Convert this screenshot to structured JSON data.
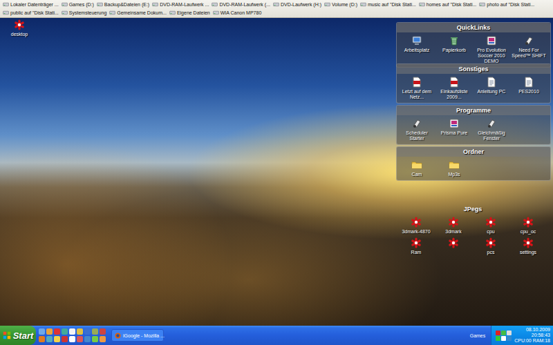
{
  "toolbar": {
    "rows": [
      [
        {
          "label": "Lokaler Datenträger ..."
        },
        {
          "label": "Games (D:)"
        },
        {
          "label": "Backup&Dateien (E:)"
        },
        {
          "label": "DVD-RAM-Laufwerk ..."
        },
        {
          "label": "DVD-RAM-Laufwerk (..."
        },
        {
          "label": "DVD-Laufwerk (H:)"
        },
        {
          "label": "Volume (D:)"
        },
        {
          "label": "music auf \"Disk Stati..."
        },
        {
          "label": "homes auf \"Disk Stati..."
        },
        {
          "label": "photo auf \"Disk Stati..."
        }
      ],
      [
        {
          "label": "public auf \"Disk Stati..."
        },
        {
          "label": "Systemsteuerung"
        },
        {
          "label": "Gemeinsame Dokum..."
        },
        {
          "label": "Eigene Dateien"
        },
        {
          "label": "WIA Canon MP780"
        }
      ]
    ]
  },
  "desktop_icons": [
    {
      "label": "desktop"
    }
  ],
  "fences": [
    {
      "title": "QuickLinks",
      "framed": true,
      "items": [
        {
          "label": "Arbeitsplatz",
          "kind": "computer"
        },
        {
          "label": "Papierkorb",
          "kind": "trash"
        },
        {
          "label": "Pro Evolution Soccer 2010 DEMO",
          "kind": "game"
        },
        {
          "label": "Need For Speed™ SHIFT",
          "kind": "app"
        }
      ]
    },
    {
      "title": "Sonstiges",
      "framed": true,
      "items": [
        {
          "label": "Letzt auf dem Netz...",
          "kind": "pdf"
        },
        {
          "label": "Einkaufsliste 2009...",
          "kind": "pdf"
        },
        {
          "label": "Anleitung PC",
          "kind": "doc"
        },
        {
          "label": "PES2010",
          "kind": "doc"
        }
      ]
    },
    {
      "title": "Programme",
      "framed": true,
      "items": [
        {
          "label": "Scheduler Starter",
          "kind": "app"
        },
        {
          "label": "Prisma Pure",
          "kind": "game"
        },
        {
          "label": "Gleichmäßig Fenster",
          "kind": "app"
        }
      ]
    },
    {
      "title": "Ordner",
      "framed": true,
      "items": [
        {
          "label": "Cam",
          "kind": "folder"
        },
        {
          "label": "Mp3s",
          "kind": "folder"
        }
      ]
    },
    {
      "title": "JPegs",
      "framed": false,
      "items": [
        {
          "label": "3dmark-4870",
          "kind": "image"
        },
        {
          "label": "3dmark",
          "kind": "image"
        },
        {
          "label": "cpu",
          "kind": "image"
        },
        {
          "label": "cpu_oc",
          "kind": "image"
        },
        {
          "label": "Ram",
          "kind": "image"
        },
        {
          "label": "",
          "kind": "image"
        },
        {
          "label": "pcs",
          "kind": "image"
        },
        {
          "label": "settings",
          "kind": "image"
        }
      ]
    }
  ],
  "taskbar": {
    "start": "Start",
    "tasks": [
      {
        "label": "iGoogle - Mozilla ...",
        "selected": false
      }
    ],
    "toolbar_label": "Games",
    "clock": {
      "date": "08.10.2009",
      "time": "20:58:43",
      "stats": "CPU:00 RAM:18"
    }
  }
}
